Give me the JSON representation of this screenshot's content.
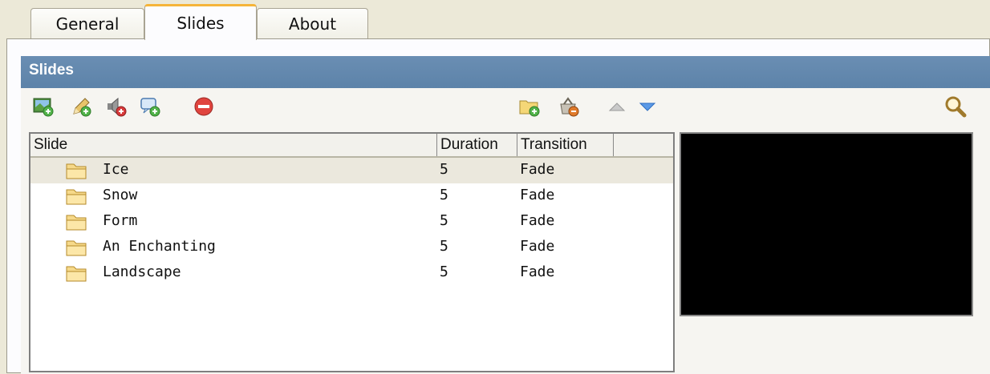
{
  "tabs": [
    {
      "label": "General",
      "active": false
    },
    {
      "label": "Slides",
      "active": true
    },
    {
      "label": "About",
      "active": false
    }
  ],
  "section": {
    "title": "Slides"
  },
  "toolbar": {
    "left_icons": [
      "add-image-icon",
      "edit-icon",
      "add-audio-icon",
      "add-caption-icon",
      "remove-icon"
    ],
    "right_icons": [
      "add-folder-icon",
      "remove-all-icon",
      "move-up-icon",
      "move-down-icon"
    ],
    "search_icon": "search-icon"
  },
  "list": {
    "columns": [
      "Slide",
      "Duration",
      "Transition"
    ],
    "rows": [
      {
        "name": "Ice",
        "duration": "5",
        "transition": "Fade",
        "selected": true
      },
      {
        "name": "Snow",
        "duration": "5",
        "transition": "Fade",
        "selected": false
      },
      {
        "name": "Form",
        "duration": "5",
        "transition": "Fade",
        "selected": false
      },
      {
        "name": "An Enchanting",
        "duration": "5",
        "transition": "Fade",
        "selected": false
      },
      {
        "name": "Landscape",
        "duration": "5",
        "transition": "Fade",
        "selected": false
      }
    ]
  },
  "colors": {
    "section_bar": "#5f85ab",
    "active_tab_accent": "#f5b43a",
    "preview_bg": "#000000"
  }
}
